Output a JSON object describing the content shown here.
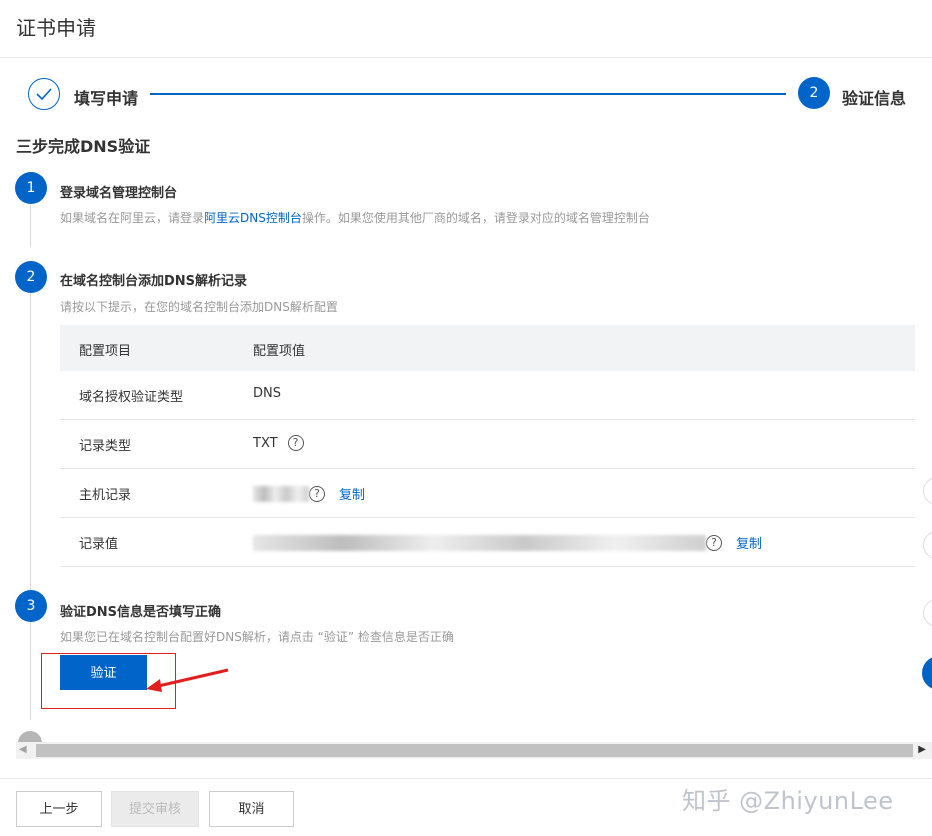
{
  "header": {
    "title": "证书申请"
  },
  "stepper": {
    "steps": [
      {
        "label": "填写申请"
      },
      {
        "number": "2",
        "label": "验证信息"
      }
    ]
  },
  "section": {
    "title": "三步完成DNS验证"
  },
  "steps": [
    {
      "number": "1",
      "title": "登录域名管理控制台",
      "desc_before": "如果域名在阿里云，请登录",
      "desc_link": "阿里云DNS控制台",
      "desc_after": "操作。如果您使用其他厂商的域名，请登录对应的域名管理控制台"
    },
    {
      "number": "2",
      "title": "在域名控制台添加DNS解析记录",
      "desc": "请按以下提示，在您的域名控制台添加DNS解析配置"
    },
    {
      "number": "3",
      "title": "验证DNS信息是否填写正确",
      "desc": "如果您已在域名控制台配置好DNS解析，请点击 “验证” 检查信息是否正确"
    }
  ],
  "table": {
    "headers": [
      "配置项目",
      "配置项值"
    ],
    "rows": [
      {
        "label": "域名授权验证类型",
        "value": "DNS"
      },
      {
        "label": "记录类型",
        "value": "TXT",
        "help": "?"
      },
      {
        "label": "主机记录",
        "help": "?",
        "copy": "复制"
      },
      {
        "label": "记录值",
        "help": "?",
        "copy": "复制"
      }
    ]
  },
  "verify_button": "验证",
  "footer": {
    "prev": "上一步",
    "submit": "提交审核",
    "cancel": "取消"
  },
  "watermark": "知乎 @ZhiyunLee",
  "colors": {
    "primary": "#0064c8",
    "highlight": "#e0201e"
  }
}
